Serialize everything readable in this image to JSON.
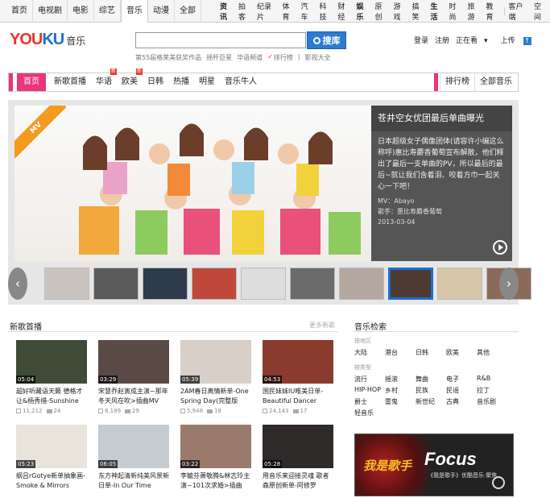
{
  "topnav": {
    "left": [
      "首页",
      "电视剧",
      "电影",
      "综艺",
      "音乐",
      "动漫",
      "全部"
    ],
    "active_index": 4,
    "right": [
      "资讯",
      "拍客",
      "纪录片",
      "体育",
      "汽车",
      "科技",
      "财经",
      "娱乐",
      "原创",
      "游戏",
      "搞笑",
      "生活",
      "时尚",
      "旅游",
      "教育"
    ],
    "right_bold": [
      "资讯",
      "娱乐",
      "生活"
    ],
    "client": "客户端",
    "space": "空间"
  },
  "header": {
    "logo_you": "YOU",
    "logo_ku": "KU",
    "logo_music": "音乐",
    "search_placeholder": "",
    "search_button": "搜库",
    "hot_links": [
      "第55届格莱美获奖作品",
      "摇杆巨星",
      "华语频道"
    ],
    "rank": "排行榜",
    "library": "影视大全",
    "login": "登录",
    "register": "注册",
    "watching": "正在看",
    "upload": "上传"
  },
  "channel_nav": {
    "items": [
      "首页",
      "新歌首播",
      "华语",
      "欧美",
      "日韩",
      "热播",
      "明星",
      "音乐牛人"
    ],
    "new_tags": [
      "华语",
      "欧美"
    ],
    "new_tag_text": "新",
    "right_items": [
      "排行榜",
      "全部音乐"
    ]
  },
  "hero": {
    "ribbon": "MV",
    "title": "苍井空女优团最后单曲曝光",
    "description": "日本超级女子偶像团体(请容许小编这么称呼)惠比寿麝香葡萄宣布解散，他们释出了最后一支单曲的PV，所以最后的最后~就让我们含着泪、咬着方巾一起关心一下吧！",
    "mv_label": "MV：Abayo",
    "singer_label": "歌手：惠比寿麝香葡萄",
    "date": "2013-03-04"
  },
  "thumb_colors": [
    "#c9c4bf",
    "#5a5a5a",
    "#2d3b4c",
    "#c0483a",
    "#ddd",
    "#6b6b6b",
    "#b4a8a0",
    "#4d3a33",
    "#d7c6a8",
    "#8b6a5a"
  ],
  "new_songs": {
    "title": "新歌首播",
    "more": "更多新歌",
    "videos": [
      {
        "dur": "05:04",
        "title": "超好听藏语天籁 德格才让&杨秀措-Sunshine",
        "plays": "11,212",
        "comments": "24",
        "color": "#3f4a37"
      },
      {
        "dur": "03:29",
        "title": "宋慧乔赵寅成主演~那年冬天风在吹>插曲MV",
        "plays": "8,189",
        "comments": "29",
        "color": "#5a4a46"
      },
      {
        "dur": "05:39",
        "title": "2AM春日离情新单-One Spring Day(完整版",
        "plays": "5,948",
        "comments": "18",
        "color": "#d8d0c8"
      },
      {
        "dur": "04:53",
        "title": "国民妹妹IU唯美日单-Beautiful Dancer",
        "plays": "24,143",
        "comments": "17",
        "color": "#8b3a2e"
      },
      {
        "dur": "05:23",
        "title": "纲吕rGotye新单抽象画-Smoke & Mirrors",
        "plays": "",
        "comments": "",
        "color": "#e8e4dc"
      },
      {
        "dur": "06:05",
        "title": "东方神起清新纯美风景新日单-In Our Time",
        "plays": "",
        "comments": "",
        "color": "#c4ccd2"
      },
      {
        "dur": "03:22",
        "title": "李毓芬萧敬腾&林志玲主演~101次求婚>插曲",
        "plays": "",
        "comments": "",
        "color": "#9a7a6a"
      },
      {
        "dur": "05:28",
        "title": "用音乐来迎接灵魂 歌者森原创新单-阿修罗",
        "plays": "",
        "comments": "",
        "color": "#2e2a2a"
      }
    ]
  },
  "retrieval": {
    "title": "音乐检索",
    "region_label": "按地区",
    "regions": [
      "大陆",
      "港台",
      "日韩",
      "欧美",
      "其他"
    ],
    "genre_label": "按类型",
    "genres": [
      "流行",
      "摇滚",
      "舞曲",
      "电子",
      "R&B",
      "HIP-HOP",
      "乡村",
      "民族",
      "民谣",
      "拉丁",
      "爵士",
      "雷鬼",
      "新世纪",
      "古典",
      "音乐剧",
      "轻音乐"
    ]
  },
  "focus": {
    "cn": "我是歌手",
    "en": "Focus",
    "sub": "《我是歌手》优酷音乐·聚焦"
  }
}
